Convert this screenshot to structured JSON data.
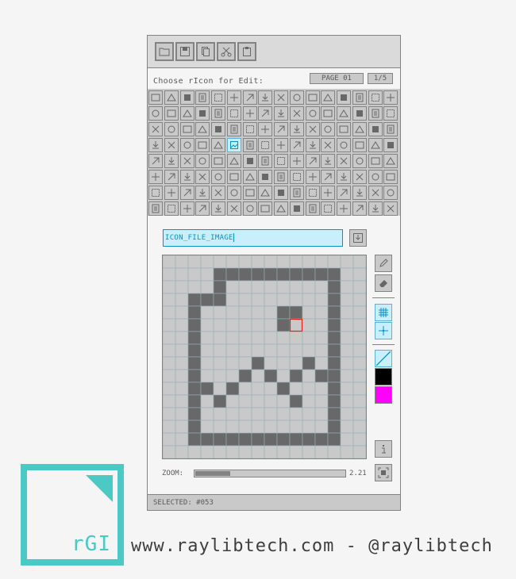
{
  "toolbar": {
    "buttons": [
      "open-file-icon",
      "save-file-icon",
      "copy-icon",
      "cut-icon",
      "paste-icon"
    ]
  },
  "selector": {
    "label": "Choose rIcon for Edit:",
    "page_label": "PAGE 01",
    "page_counter": "1/5"
  },
  "icon_grid": {
    "rows": 8,
    "cols": 16,
    "selected_index": 53
  },
  "editor": {
    "icon_name": "ICON_FILE_IMAGE",
    "pixel_grid_size": 16,
    "fill_color": "#686868",
    "highlight_cell_color": "#e62222"
  },
  "side_tools": [
    "pencil-icon",
    "eraser-icon",
    "grid-toggle-icon",
    "crosshair-icon",
    "transparent-color-swatch",
    "black-color-swatch",
    "magenta-color-swatch",
    "info-icon",
    "fit-screen-icon"
  ],
  "colors": {
    "black_swatch": "#000000",
    "magenta_swatch": "#ff00ff",
    "accent": "#4cc9c4"
  },
  "zoom": {
    "label": "ZOOM:",
    "value": "2.21",
    "fraction": 0.23
  },
  "status": {
    "text": "SELECTED: #053"
  },
  "branding": {
    "logo": "rGI",
    "web": "www.raylibtech.com - @raylibtech"
  }
}
